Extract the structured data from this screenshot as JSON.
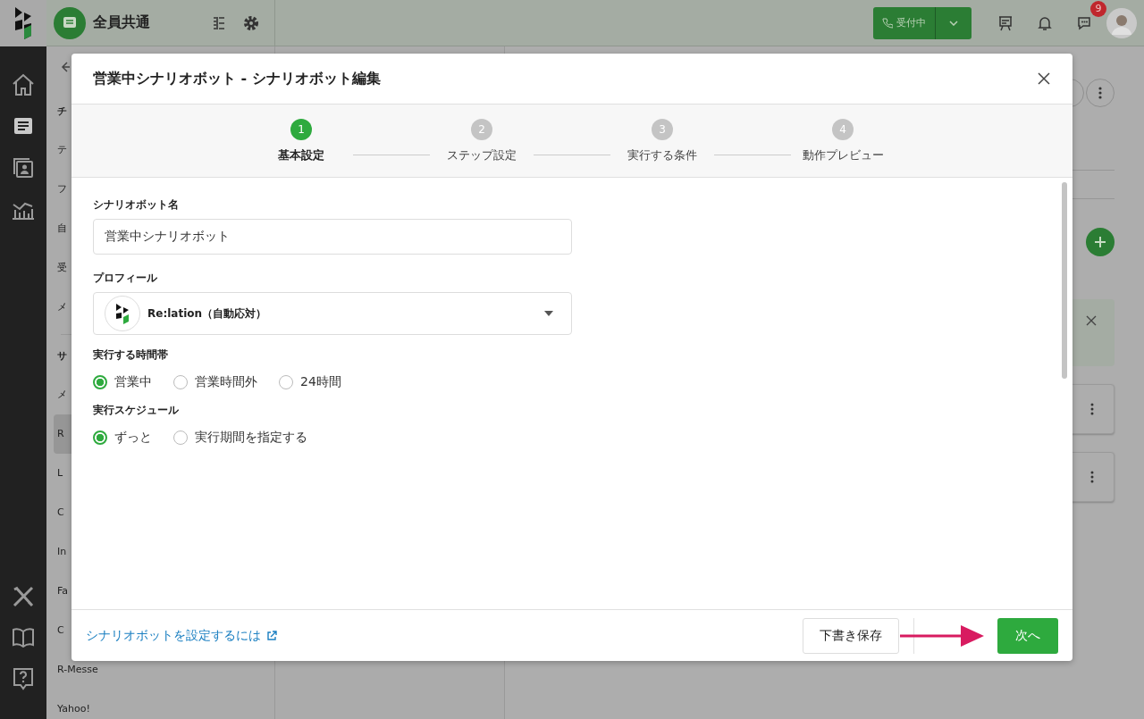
{
  "app_bar": {
    "workspace": "全員共通",
    "status_button": "受付中",
    "notification_badge": "9"
  },
  "side_list": {
    "items": [
      {
        "label": "チ",
        "kind": "heading"
      },
      {
        "label": "テ",
        "kind": "item",
        "selected": false
      },
      {
        "label": "フ",
        "kind": "item",
        "selected": false
      },
      {
        "label": "自",
        "kind": "item",
        "selected": false
      },
      {
        "label": "受",
        "kind": "item",
        "selected": false
      },
      {
        "label": "メ",
        "kind": "item",
        "selected": false
      },
      {
        "label": "サ",
        "kind": "heading"
      },
      {
        "label": "メ",
        "kind": "item",
        "selected": false
      },
      {
        "label": "R",
        "kind": "item",
        "selected": true
      },
      {
        "label": "L",
        "kind": "item",
        "selected": false
      },
      {
        "label": "C",
        "kind": "item",
        "selected": false
      },
      {
        "label": "In",
        "kind": "item",
        "selected": false
      },
      {
        "label": "Fa",
        "kind": "item",
        "selected": false
      },
      {
        "label": "C",
        "kind": "item",
        "selected": false
      },
      {
        "label": "R-Messe",
        "kind": "item",
        "selected": false
      },
      {
        "label": "Yahoo!",
        "kind": "item",
        "selected": false
      }
    ]
  },
  "dialog": {
    "title": "営業中シナリオボット - シナリオボット編集",
    "steps": [
      {
        "number": "1",
        "label": "基本設定",
        "selected": true
      },
      {
        "number": "2",
        "label": "ステップ設定",
        "selected": false
      },
      {
        "number": "3",
        "label": "実行する条件",
        "selected": false
      },
      {
        "number": "4",
        "label": "動作プレビュー",
        "selected": false
      }
    ],
    "name_field": {
      "label": "シナリオボット名",
      "value": "営業中シナリオボット"
    },
    "profile_field": {
      "label": "プロフィール",
      "value": "Re:lation（自動応対）"
    },
    "radio_groups": [
      {
        "label": "実行する時間帯",
        "options": [
          {
            "label": "営業中",
            "selected": true
          },
          {
            "label": "営業時間外",
            "selected": false
          },
          {
            "label": "24時間",
            "selected": false
          }
        ]
      },
      {
        "label": "実行スケジュール",
        "options": [
          {
            "label": "ずっと",
            "selected": true
          },
          {
            "label": "実行期間を指定する",
            "selected": false
          }
        ]
      }
    ],
    "footer": {
      "help_link": "シナリオボットを設定するには",
      "save_draft_button": "下書き保存",
      "next_button": "次へ"
    }
  }
}
